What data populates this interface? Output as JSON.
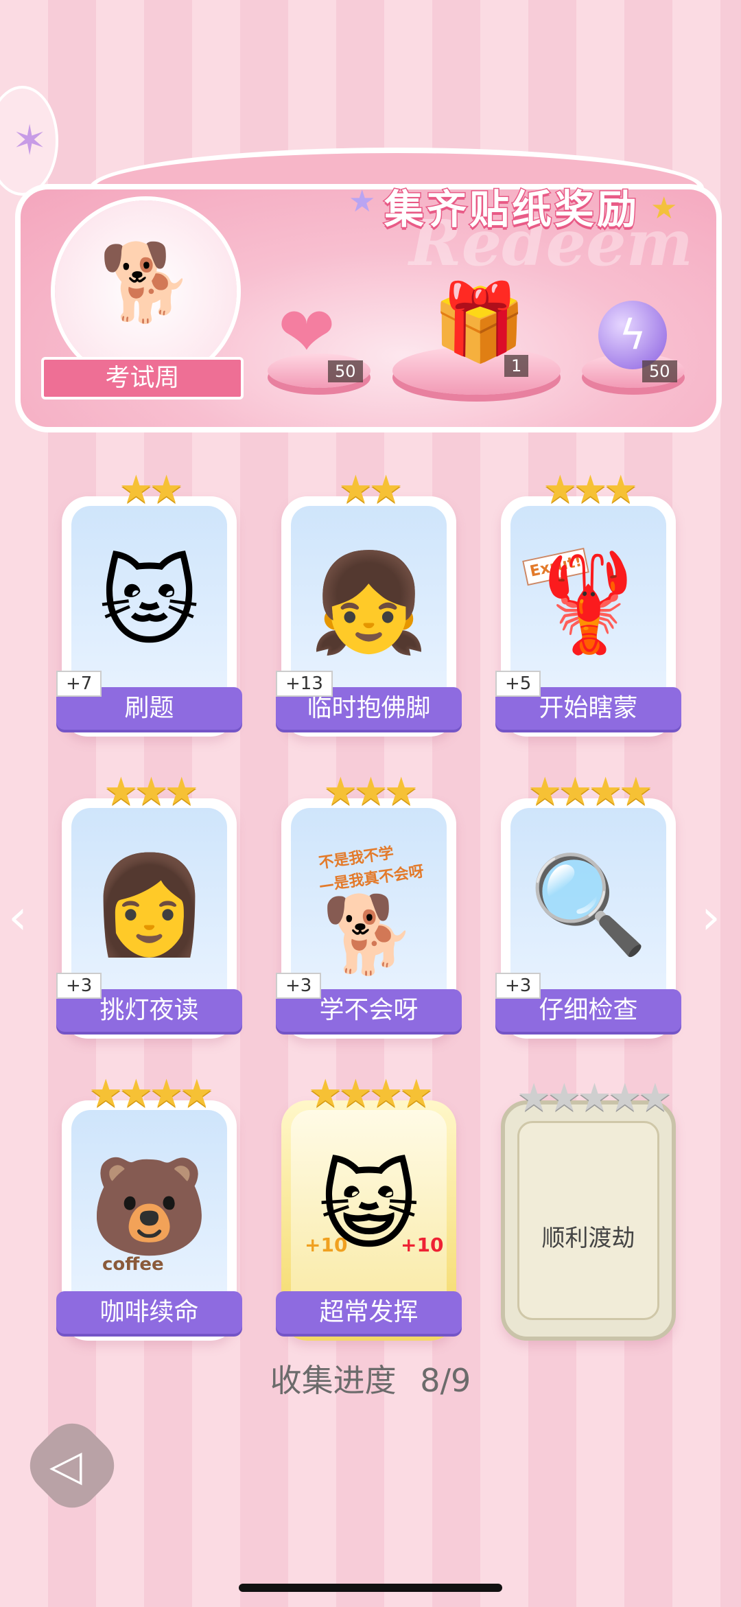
{
  "banner": {
    "title": "集齐贴纸奖励",
    "watermark": "Redeem",
    "theme_label": "考试周",
    "rewards": [
      {
        "name": "heart-gem",
        "count": "50"
      },
      {
        "name": "gift-box",
        "count": "1"
      },
      {
        "name": "lightning-orb",
        "count": "50"
      }
    ]
  },
  "stickers": [
    {
      "name": "刷题",
      "stars": 2,
      "bonus": "+7",
      "icon": "cat"
    },
    {
      "name": "临时抱佛脚",
      "stars": 2,
      "bonus": "+13",
      "icon": "girl-reading"
    },
    {
      "name": "开始瞎蒙",
      "stars": 3,
      "bonus": "+5",
      "icon": "lobster"
    },
    {
      "name": "挑灯夜读",
      "stars": 3,
      "bonus": "+3",
      "icon": "girl-desk"
    },
    {
      "name": "学不会呀",
      "stars": 3,
      "bonus": "+3",
      "icon": "shiba"
    },
    {
      "name": "仔细检查",
      "stars": 4,
      "bonus": "+3",
      "icon": "girl-magnifier"
    },
    {
      "name": "咖啡续命",
      "stars": 4,
      "bonus": "",
      "icon": "bear-coffee"
    },
    {
      "name": "超常发挥",
      "stars": 4,
      "bonus": "",
      "icon": "cat-pencil"
    },
    {
      "name": "顺利渡劫",
      "stars": 5,
      "bonus": "",
      "icon": "locked"
    }
  ],
  "sticker_texts": {
    "lobster_sign": "Exrut!",
    "shiba_caption_1": "不是我不学",
    "shiba_caption_2": "—是我真不会呀",
    "coffee_word": "coffee",
    "plus_ten": "+10"
  },
  "progress": {
    "label": "收集进度",
    "value": "8/9"
  }
}
